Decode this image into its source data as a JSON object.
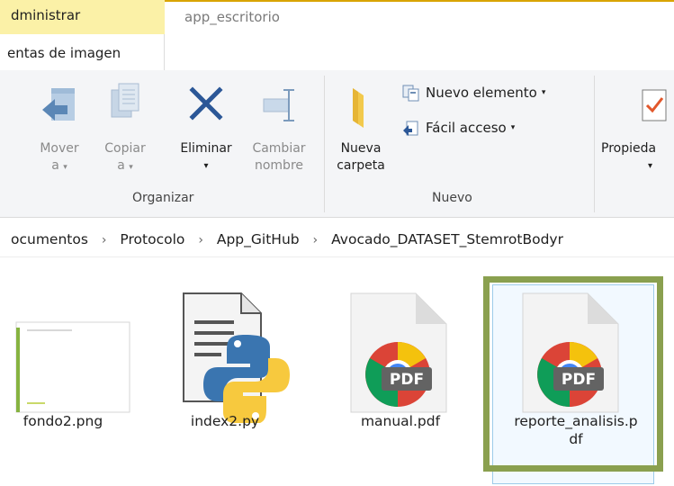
{
  "window": {
    "context_tab": "dministrar",
    "title": "app_escritorio",
    "subtab": "entas de imagen"
  },
  "ribbon": {
    "organize": {
      "label": "Organizar",
      "move": {
        "line1": "Mover",
        "line2": "a"
      },
      "copy": {
        "line1": "Copiar",
        "line2": "a"
      },
      "delete": {
        "label": "Eliminar"
      },
      "rename": {
        "line1": "Cambiar",
        "line2": "nombre"
      }
    },
    "new": {
      "label": "Nuevo",
      "new_folder": {
        "line1": "Nueva",
        "line2": "carpeta"
      },
      "new_item": "Nuevo elemento",
      "easy_access": "Fácil acceso"
    },
    "open": {
      "properties": "Propieda"
    }
  },
  "address": {
    "crumbs": [
      "ocumentos",
      "Protocolo",
      "App_GitHub",
      "Avocado_DATASET_StemrotBodyr"
    ]
  },
  "files": [
    {
      "name": "fondo2.png",
      "type": "image"
    },
    {
      "name": "index2.py",
      "type": "python"
    },
    {
      "name": "manual.pdf",
      "type": "pdf"
    },
    {
      "name": "reporte_analisis.pdf",
      "line1": "reporte_analisis.p",
      "line2": "df",
      "type": "pdf",
      "selected": true
    }
  ],
  "icons": {
    "move": "move-to-icon",
    "copy": "copy-to-icon",
    "delete": "delete-x-icon",
    "rename": "rename-icon",
    "new_folder": "new-folder-icon",
    "properties": "properties-check-icon",
    "pdf_badge": "PDF"
  },
  "colors": {
    "context_tab": "#fbf1a7",
    "accent_line": "#d9a400",
    "selection_outline": "#8aa04f",
    "delete_x": "#2b5797"
  }
}
